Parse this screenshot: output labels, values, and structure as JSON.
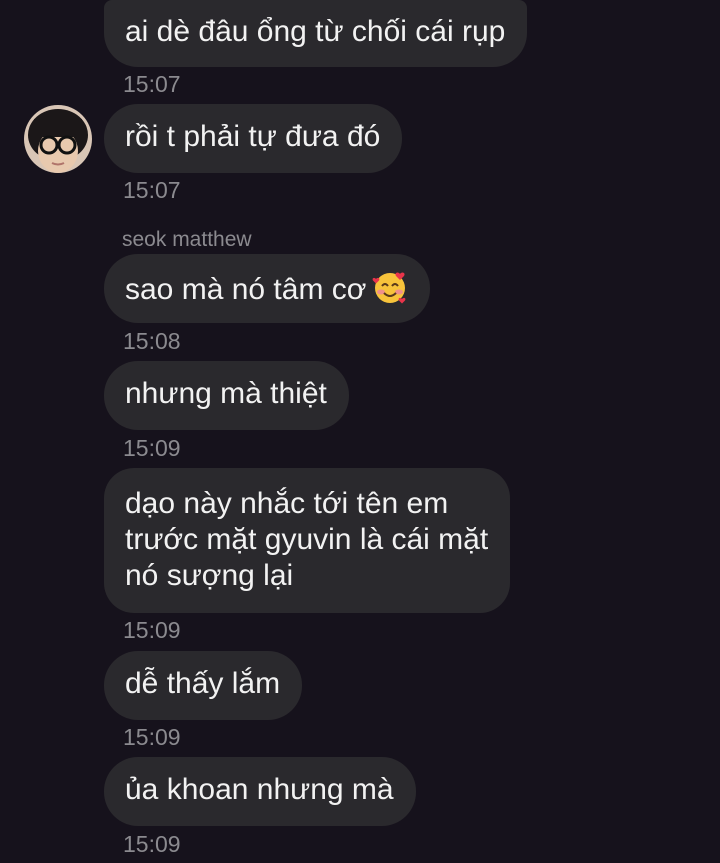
{
  "messages": [
    {
      "text": "ai dè đâu ổng từ chối cái rụp",
      "time": "15:07"
    },
    {
      "text": "rồi t phải tự đưa đó",
      "time": "15:07"
    },
    {
      "sender": "seok matthew",
      "text": "sao mà nó tâm cơ",
      "emoji": "smiling-face-with-hearts-icon",
      "time": "15:08"
    },
    {
      "text": "nhưng mà thiệt",
      "time": "15:09"
    },
    {
      "lines": [
        "dạo này nhắc tới tên em",
        "trước mặt gyuvin là cái mặt",
        "nó sượng lại"
      ],
      "time": "15:09"
    },
    {
      "text": "dễ thấy lắm",
      "time": "15:09"
    },
    {
      "text": "ủa khoan nhưng mà",
      "time": "15:09"
    }
  ],
  "colors": {
    "background": "#16121c",
    "bubble": "#2a292d",
    "text": "#f2f2f2",
    "meta": "#8b8a8f"
  }
}
